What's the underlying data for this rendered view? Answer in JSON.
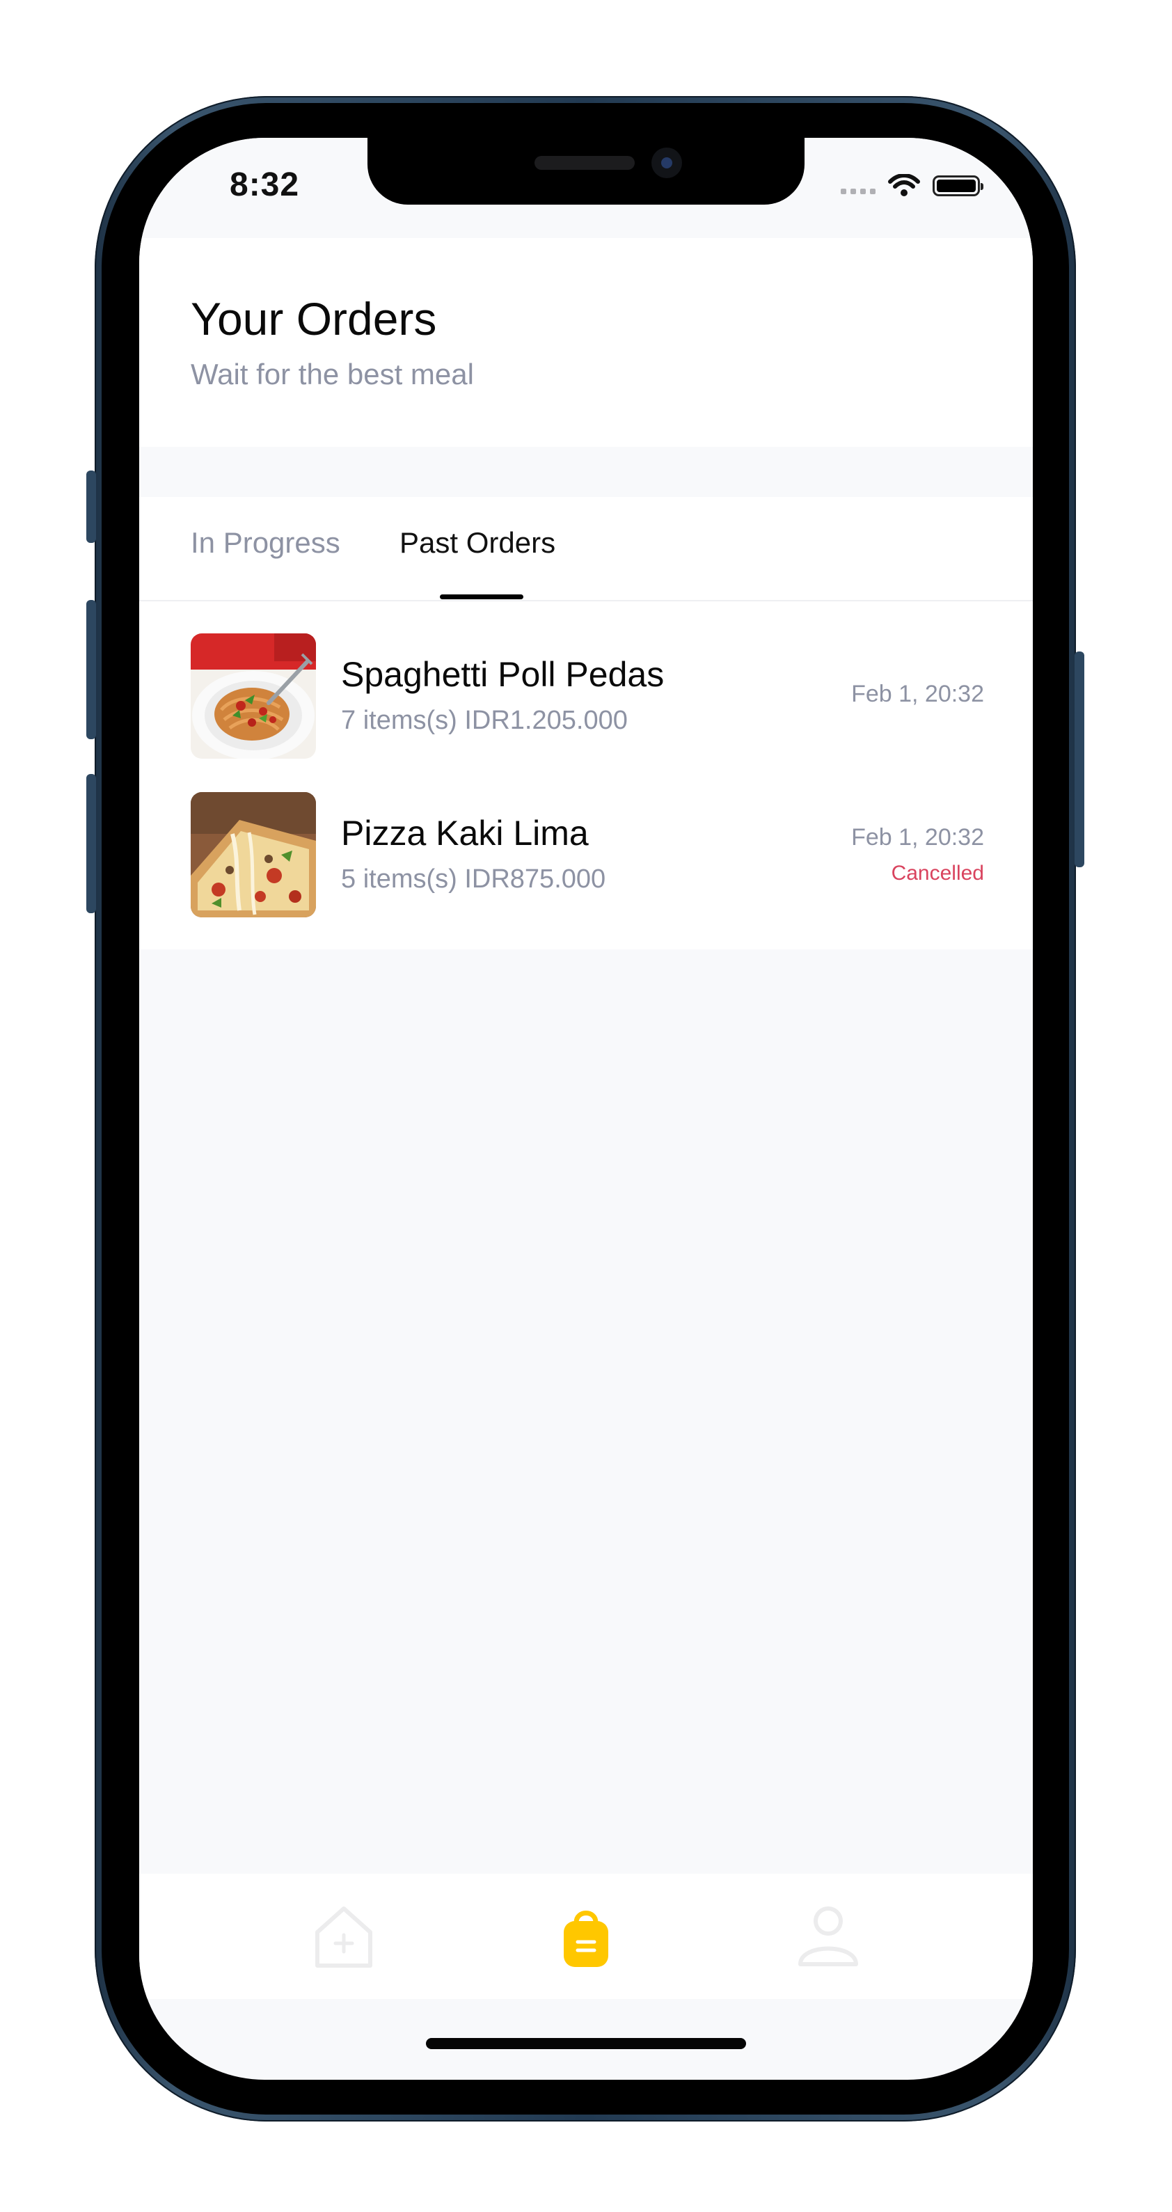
{
  "status_bar": {
    "time": "8:32"
  },
  "header": {
    "title": "Your Orders",
    "subtitle": "Wait for the best meal"
  },
  "tabs": [
    {
      "label": "In Progress",
      "active": false
    },
    {
      "label": "Past Orders",
      "active": true
    }
  ],
  "orders": [
    {
      "name": "Spaghetti Poll Pedas",
      "meta": "7 items(s) IDR1.205.000",
      "date": "Feb 1, 20:32",
      "status": ""
    },
    {
      "name": "Pizza Kaki Lima",
      "meta": "5 items(s) IDR875.000",
      "date": "Feb 1, 20:32",
      "status": "Cancelled"
    }
  ],
  "bottom_nav": [
    {
      "icon": "home-icon",
      "active": false
    },
    {
      "icon": "shopping-bag-icon",
      "active": true
    },
    {
      "icon": "profile-icon",
      "active": false
    }
  ],
  "colors": {
    "accent": "#FFC700",
    "muted_text": "#8D92A3",
    "cancelled": "#D9435E",
    "background": "#F8F9FB"
  }
}
